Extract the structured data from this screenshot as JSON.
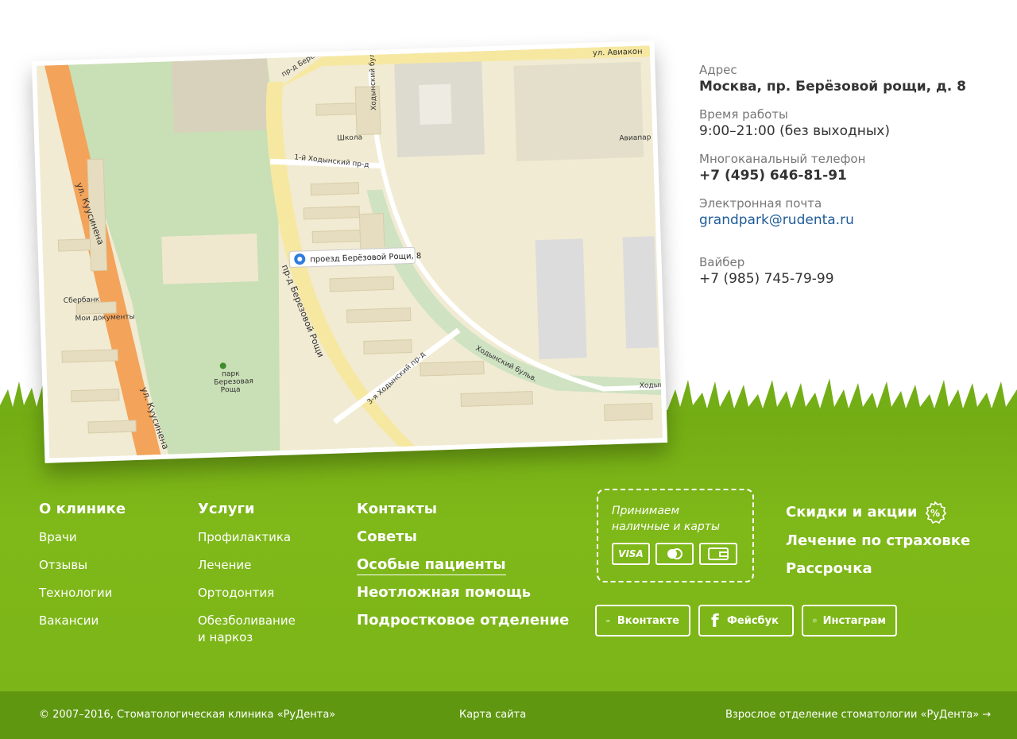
{
  "map": {
    "pin_label": "проезд Берёзовой Рощи, 8",
    "labels": {
      "kusinena_1": "ул. Куусинена",
      "kusinena_2": "ул. Куусинена",
      "birch_proezd": "пр-д Березовой Рощи",
      "birch_top": "пр-д Берез",
      "aviakon": "ул. Авиакон",
      "hod_1": "1-й Ходынский пр-д",
      "hod_3": "3-я Ходынский пр-д",
      "hod_bul_1": "Ходынский бульв.",
      "hod_bul_2": "Ходынский бульв.",
      "hod_bul_3": "Ходын",
      "school": "Школа",
      "sberbank": "Сбербанк",
      "moi_docs": "Мои документы",
      "park": "парк",
      "park2": "Березовая",
      "park3": "Роща",
      "aviapark": "Авиапар"
    }
  },
  "info": {
    "address_label": "Адрес",
    "address_value": "Москва, пр. Берёзовой рощи, д. 8",
    "hours_label": "Время работы",
    "hours_value": "9:00–21:00 (без выходных)",
    "phone_label": "Многоканальный телефон",
    "phone_value": "+7 (495) 646-81-91",
    "email_label": "Электронная почта",
    "email_value": "grandpark@rudenta.ru",
    "viber_label": "Вайбер",
    "viber_value": "+7 (985) 745-79-99"
  },
  "nav": {
    "col1": {
      "title": "О клинике",
      "items": [
        "Врачи",
        "Отзывы",
        "Технологии",
        "Вакансии"
      ]
    },
    "col2": {
      "title": "Услуги",
      "items": [
        "Профилактика",
        "Лечение",
        "Ортодонтия",
        "Обезболивание",
        "и наркоз"
      ]
    },
    "col3": {
      "items": [
        "Контакты",
        "Советы",
        "Особые пациенты",
        "Неотложная помощь",
        "Подростковое отделение"
      ]
    },
    "col5": {
      "items": [
        "Скидки и акции",
        "Лечение по страховке",
        "Рассрочка"
      ]
    }
  },
  "payment": {
    "text_line1": "Принимаем",
    "text_line2": "наличные и карты",
    "visa": "VISA"
  },
  "social": {
    "vk": "Вконтакте",
    "fb": "Фейсбук",
    "ig": "Инстаграм"
  },
  "footer": {
    "copyright": "© 2007–2016, Стоматологическая клиника «РуДента»",
    "sitemap": "Карта сайта",
    "adult": "Взрослое отделение стоматологии «РуДента» →"
  },
  "colors": {
    "green": "#7cb518",
    "dark_green": "#5f9711",
    "link_blue": "#1f5c99"
  }
}
